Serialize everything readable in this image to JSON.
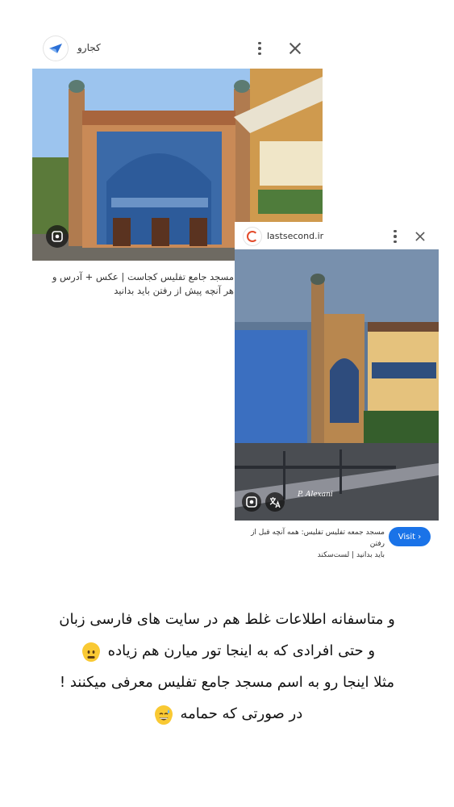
{
  "card1": {
    "site_name": "کجارو",
    "caption_line1": "مسجد جامع تفلیس کجاست | عکس + آدرس و",
    "caption_line2": "هر آنچه پیش از رفتن باید بدانید"
  },
  "card2": {
    "site_name": "lastsecond.ir",
    "watermark": "P. Alexani",
    "caption_line1": "مسجد جمعه تفلیس تفلیس: همه آنچه قبل از رفتن",
    "caption_line2": "باید بدانید | لست‌سکند",
    "visit_label": "Visit ›"
  },
  "post": {
    "line1": "و متاسفانه اطلاعات  غلط هم در سایت های فارسی زبان",
    "line2": "و حتی افرادی که به اینجا تور میارن هم زیاده",
    "line3": "مثلا اینجا رو به اسم مسجد جامع تفلیس معرفی میکنند !",
    "line4": "در صورتی که حمامه",
    "emoji1": "neutral-face-emoji",
    "emoji2": "grinning-sweat-emoji"
  },
  "colors": {
    "accent": "#1a73e8",
    "text": "#222222"
  }
}
